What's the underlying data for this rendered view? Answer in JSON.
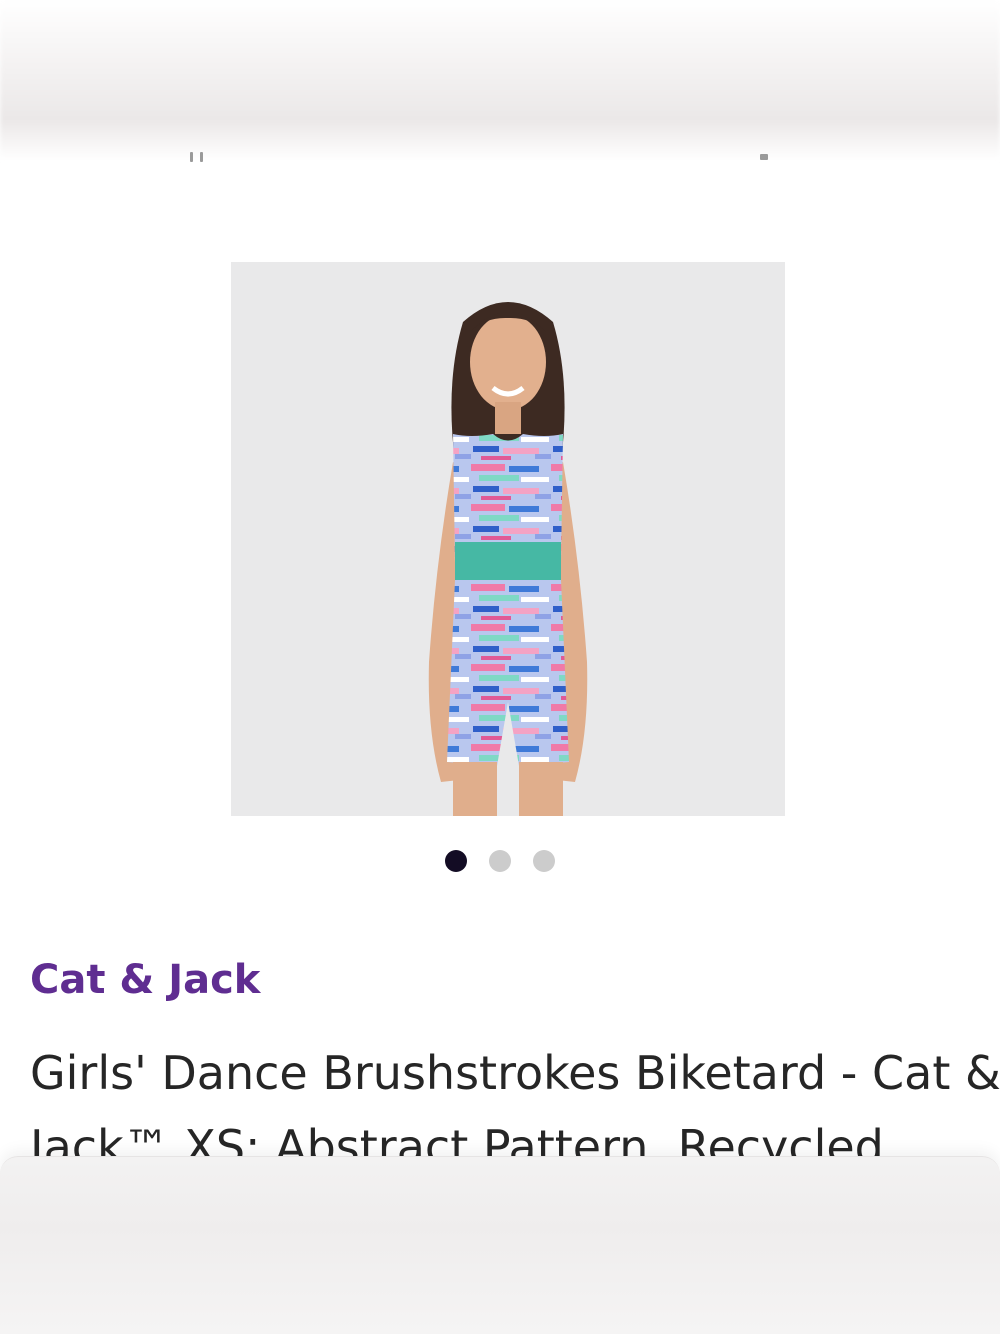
{
  "gallery": {
    "image_alt": "Girl wearing brushstroke print biketard",
    "dots_total": 3,
    "active_index": 0
  },
  "product": {
    "brand": "Cat & Jack",
    "title_line1": "Girls' Dance Brushstrokes Biketard - Cat &",
    "title_line2": "Jack™ XS: Abstract Pattern, Recycled"
  },
  "colors": {
    "brand": "#5f2d91",
    "active_dot": "#130c24",
    "inactive_dot": "#cccccc"
  }
}
